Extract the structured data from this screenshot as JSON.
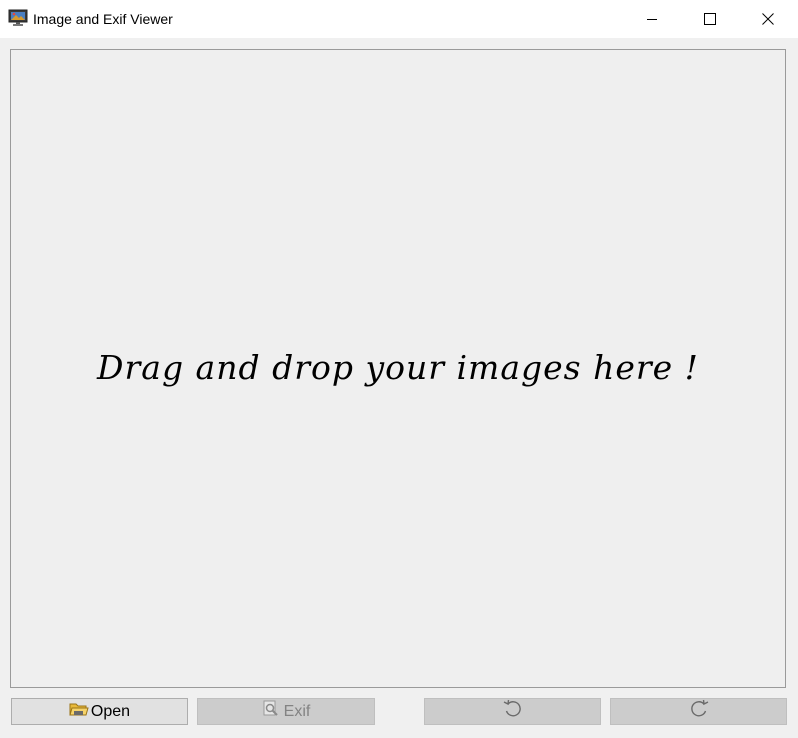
{
  "window": {
    "title": "Image and Exif Viewer",
    "icon": "app-picture-monitor-icon",
    "controls": [
      "minimize-icon",
      "maximize-icon",
      "close-icon"
    ]
  },
  "drop_area": {
    "message": "Drag and drop your images here !"
  },
  "toolbar": {
    "open_label": "Open",
    "open_icon": "folder-icon",
    "exif_label": "Exif",
    "exif_icon": "magnifier-document-icon",
    "exif_enabled": false,
    "rotate_left_icon": "rotate-left-icon",
    "rotate_left_enabled": false,
    "rotate_right_icon": "rotate-right-icon",
    "rotate_right_enabled": false
  },
  "colors": {
    "background": "#f0f0f0",
    "titlebar": "#ffffff",
    "disabled_button": "#cccccc",
    "disabled_text": "#838383"
  }
}
